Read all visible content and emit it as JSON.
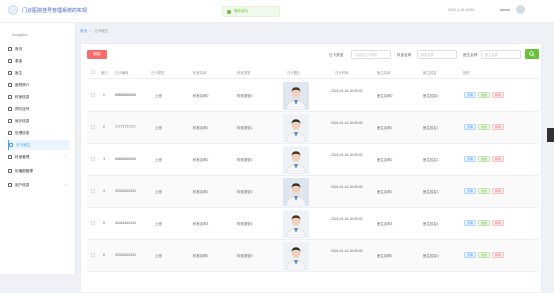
{
  "header": {
    "title": "门诊医院挂号管理系统的实现",
    "toast": "操作成功",
    "datetime": "2024-1-16 16:54",
    "user": "admin"
  },
  "sidebar": {
    "label": "Navigation",
    "items": [
      {
        "label": "首页",
        "icon": "home-icon",
        "active": false
      },
      {
        "label": "患者",
        "icon": "grid-icon",
        "active": false
      },
      {
        "label": "医生",
        "icon": "grid-icon",
        "active": false
      },
      {
        "label": "医院简介",
        "icon": "grid-icon",
        "active": false
      },
      {
        "label": "科室信息",
        "icon": "grid-icon",
        "active": false
      },
      {
        "label": "预约挂号",
        "icon": "grid-icon",
        "active": false
      },
      {
        "label": "就诊信息",
        "icon": "grid-icon",
        "active": false
      },
      {
        "label": "处理信息",
        "icon": "grid-icon",
        "active": false
      },
      {
        "label": "日卡医生",
        "icon": "grid-icon",
        "active": true
      },
      {
        "label": "科室管理",
        "icon": "grid-icon",
        "active": false
      },
      {
        "label": "轮播图管理",
        "icon": "grid-icon",
        "active": false
      },
      {
        "label": "用户信息",
        "icon": "grid-icon",
        "active": false
      }
    ]
  },
  "breadcrumb": {
    "home": "首页",
    "sep": "/",
    "current": "日卡医生"
  },
  "toolbar": {
    "delete_label": "删除",
    "filter1_label": "日卡类型",
    "filter1_placeholder": "请选择日卡类型",
    "filter2_label": "科室名称",
    "filter2_placeholder": "科室名称",
    "filter3_label": "医生名称",
    "filter3_placeholder": "医生名称",
    "search_icon": "search-icon"
  },
  "table": {
    "columns": [
      "索引",
      "日卡编号",
      "日卡类型",
      "科室名称",
      "科室类型",
      "日卡图片",
      "日卡时间",
      "医生名称",
      "医生姓名",
      "操作"
    ],
    "rows": [
      {
        "index": "1",
        "code": "88888888888",
        "type": "上班",
        "dept": "科室名称0",
        "dtype": "科室类型0",
        "time": "2024-01-16 16:50:00",
        "docname": "医生名称0",
        "docfull": "医生姓名0"
      },
      {
        "index": "2",
        "code": "77777777777",
        "type": "上班",
        "dept": "科室名称1",
        "dtype": "科室类型1",
        "time": "2024-01-16 16:50:00",
        "docname": "医生名称1",
        "docfull": "医生姓名1"
      },
      {
        "index": "3",
        "code": "66666666666",
        "type": "上班",
        "dept": "科室名称2",
        "dtype": "科室类型2",
        "time": "2024-01-16 16:50:00",
        "docname": "医生名称2",
        "docfull": "医生姓名2"
      },
      {
        "index": "4",
        "code": "33333333333",
        "type": "上班",
        "dept": "科室名称3",
        "dtype": "科室类型3",
        "time": "2024-01-16 16:50:00",
        "docname": "医生名称3",
        "docfull": "医生姓名3"
      },
      {
        "index": "5",
        "code": "44444444444",
        "type": "上班",
        "dept": "科室名称4",
        "dtype": "科室类型4",
        "time": "2024-01-16 16:50:00",
        "docname": "医生名称4",
        "docfull": "医生姓名4"
      },
      {
        "index": "6",
        "code": "33333333333",
        "type": "上班",
        "dept": "科室名称5",
        "dtype": "科室类型5",
        "time": "2024-01-16 16:50:00",
        "docname": "医生名称5",
        "docfull": "医生姓名5"
      }
    ],
    "ops": {
      "view": "查看",
      "edit": "修改",
      "delete": "删除"
    }
  }
}
